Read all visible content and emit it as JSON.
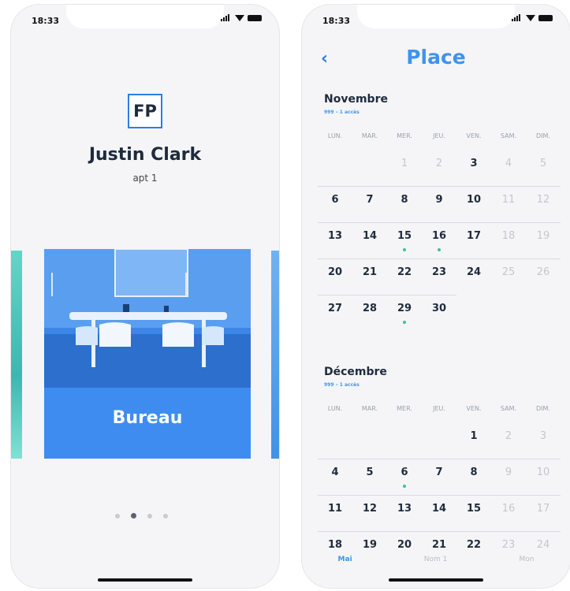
{
  "left_screen": {
    "status_time": "18:33",
    "logo_text": "FP",
    "user_name": "Justin Clark",
    "user_sub": "apt 1",
    "card_title": "Bureau",
    "pager_count": 4,
    "pager_active": 1
  },
  "right_screen": {
    "status_time": "18:33",
    "back_icon": "‹",
    "title": "Place",
    "months": [
      {
        "name": "Novembre",
        "sub": "999 – 1 accès",
        "weekdays": [
          "LUN.",
          "MAR.",
          "MER.",
          "JEU.",
          "VEN.",
          "SAM.",
          "DIM."
        ],
        "weeks": [
          [
            null,
            null,
            "1",
            "2",
            "3",
            "4",
            "5"
          ],
          [
            "6",
            "7",
            "8",
            "9",
            "10",
            "11",
            "12"
          ],
          [
            "13",
            "14",
            "15",
            "16",
            "17",
            "18",
            "19"
          ],
          [
            "20",
            "21",
            "22",
            "23",
            "24",
            "25",
            "26"
          ],
          [
            "27",
            "28",
            "29",
            "30",
            null,
            null,
            null
          ]
        ],
        "past_days": [
          "1",
          "2"
        ],
        "event_days": [
          "15",
          "16",
          "29"
        ]
      },
      {
        "name": "Décembre",
        "sub": "999 – 1 accès",
        "weekdays": [
          "LUN.",
          "MAR.",
          "MER.",
          "JEU.",
          "VEN.",
          "SAM.",
          "DIM."
        ],
        "weeks": [
          [
            null,
            null,
            null,
            null,
            "1",
            "2",
            "3"
          ],
          [
            "4",
            "5",
            "6",
            "7",
            "8",
            "9",
            "10"
          ],
          [
            "11",
            "12",
            "13",
            "14",
            "15",
            "16",
            "17"
          ],
          [
            "18",
            "19",
            "20",
            "21",
            "22",
            "23",
            "24"
          ]
        ],
        "past_days": [],
        "event_days": [
          "6"
        ]
      }
    ],
    "tabs": [
      {
        "label": "Mai",
        "active": true
      },
      {
        "label": "Nom 1",
        "active": false
      },
      {
        "label": "Mon",
        "active": false
      }
    ]
  },
  "colors": {
    "accent": "#3f93ee",
    "card": "#3e8cf0",
    "event_dot": "#3ec28f"
  }
}
